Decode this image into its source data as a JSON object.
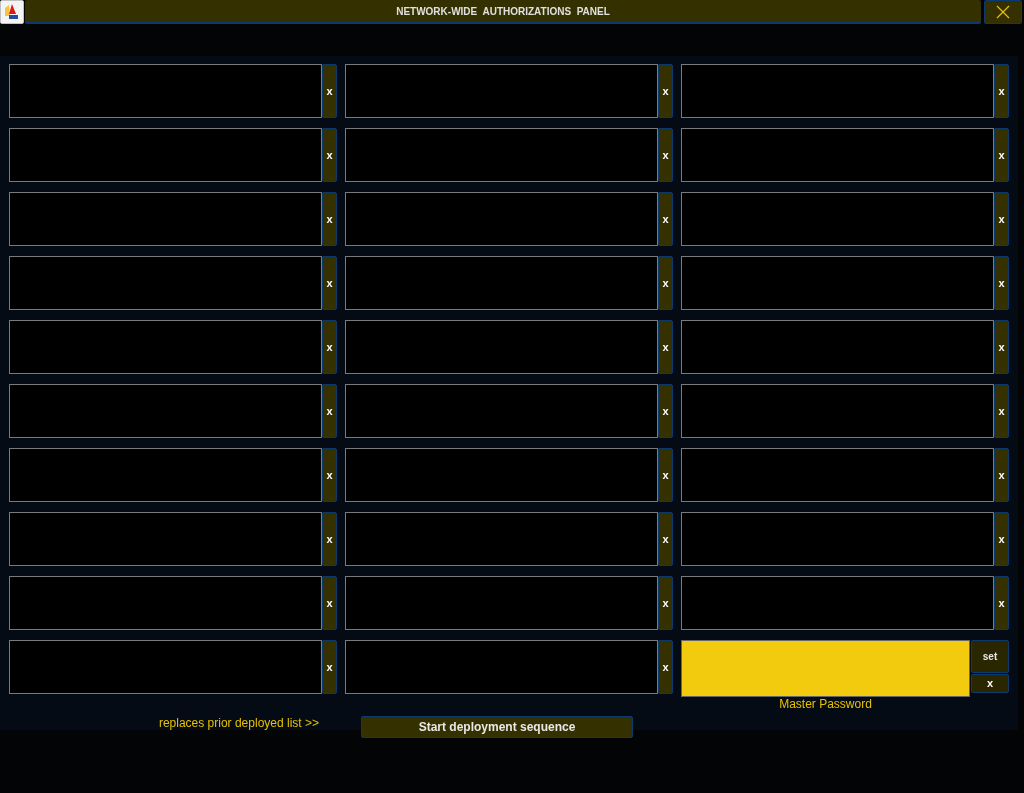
{
  "window": {
    "title": "NETWORK-WIDE  AUTHORIZATIONS  PANEL"
  },
  "columns": [
    {
      "entries": [
        {
          "clear": "x"
        },
        {
          "clear": "x"
        },
        {
          "clear": "x"
        },
        {
          "clear": "x"
        },
        {
          "clear": "x"
        },
        {
          "clear": "x"
        },
        {
          "clear": "x"
        },
        {
          "clear": "x"
        },
        {
          "clear": "x"
        },
        {
          "clear": "x"
        }
      ],
      "footer": {
        "kind": "note",
        "text": "replaces prior deployed list >>"
      }
    },
    {
      "entries": [
        {
          "clear": "x"
        },
        {
          "clear": "x"
        },
        {
          "clear": "x"
        },
        {
          "clear": "x"
        },
        {
          "clear": "x"
        },
        {
          "clear": "x"
        },
        {
          "clear": "x"
        },
        {
          "clear": "x"
        },
        {
          "clear": "x"
        },
        {
          "clear": "x"
        }
      ],
      "footer": {
        "kind": "button",
        "text": "Start deployment sequence"
      }
    },
    {
      "entries": [
        {
          "clear": "x"
        },
        {
          "clear": "x"
        },
        {
          "clear": "x"
        },
        {
          "clear": "x"
        },
        {
          "clear": "x"
        },
        {
          "clear": "x"
        },
        {
          "clear": "x"
        },
        {
          "clear": "x"
        },
        {
          "clear": "x"
        }
      ],
      "footer": {
        "kind": "master",
        "label": "Master Password",
        "set": "set",
        "clear": "x"
      }
    }
  ]
}
